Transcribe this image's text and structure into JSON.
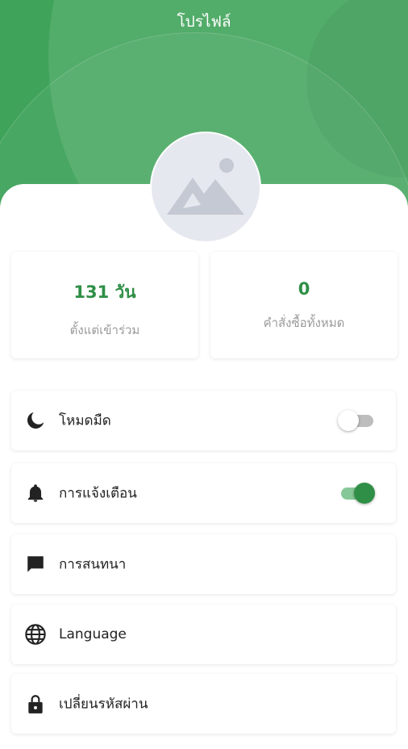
{
  "header": {
    "title": "โปรไฟล์"
  },
  "stats": [
    {
      "value": "131 วัน",
      "label": "ตั้งแต่เข้าร่วม"
    },
    {
      "value": "0",
      "label": "คำสั่งซื้อทั้งหมด"
    }
  ],
  "settings": [
    {
      "label": "โหมดมืด",
      "icon": "moon-icon",
      "toggle": "off"
    },
    {
      "label": "การแจ้งเตือน",
      "icon": "bell-icon",
      "toggle": "on"
    },
    {
      "label": "การสนทนา",
      "icon": "chat-icon"
    },
    {
      "label": "Language",
      "icon": "globe-icon"
    },
    {
      "label": "เปลี่ยนรหัสผ่าน",
      "icon": "lock-icon"
    }
  ],
  "colors": {
    "header_green": "#3fa35a",
    "accent_green": "#2f8f46",
    "toggle_on_track": "#86c897",
    "toggle_off_track": "#bdbdbd"
  }
}
